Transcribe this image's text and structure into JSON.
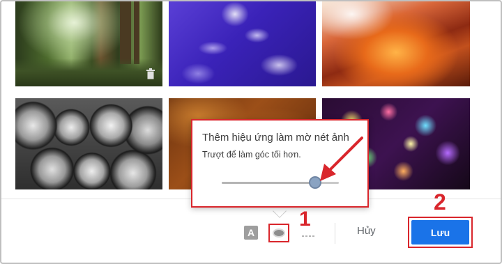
{
  "popup": {
    "title": "Thêm hiệu ứng làm mờ nét ảnh",
    "subtitle": "Trượt để làm góc tối hơn.",
    "slider_value": 0.8
  },
  "toolbar": {
    "font_icon_letter": "A",
    "cancel_label": "Hủy",
    "save_label": "Lưu"
  },
  "annotations": {
    "step1": "1",
    "step2": "2"
  },
  "colors": {
    "accent_blue": "#1a73e8",
    "annotation_red": "#d9262c"
  }
}
